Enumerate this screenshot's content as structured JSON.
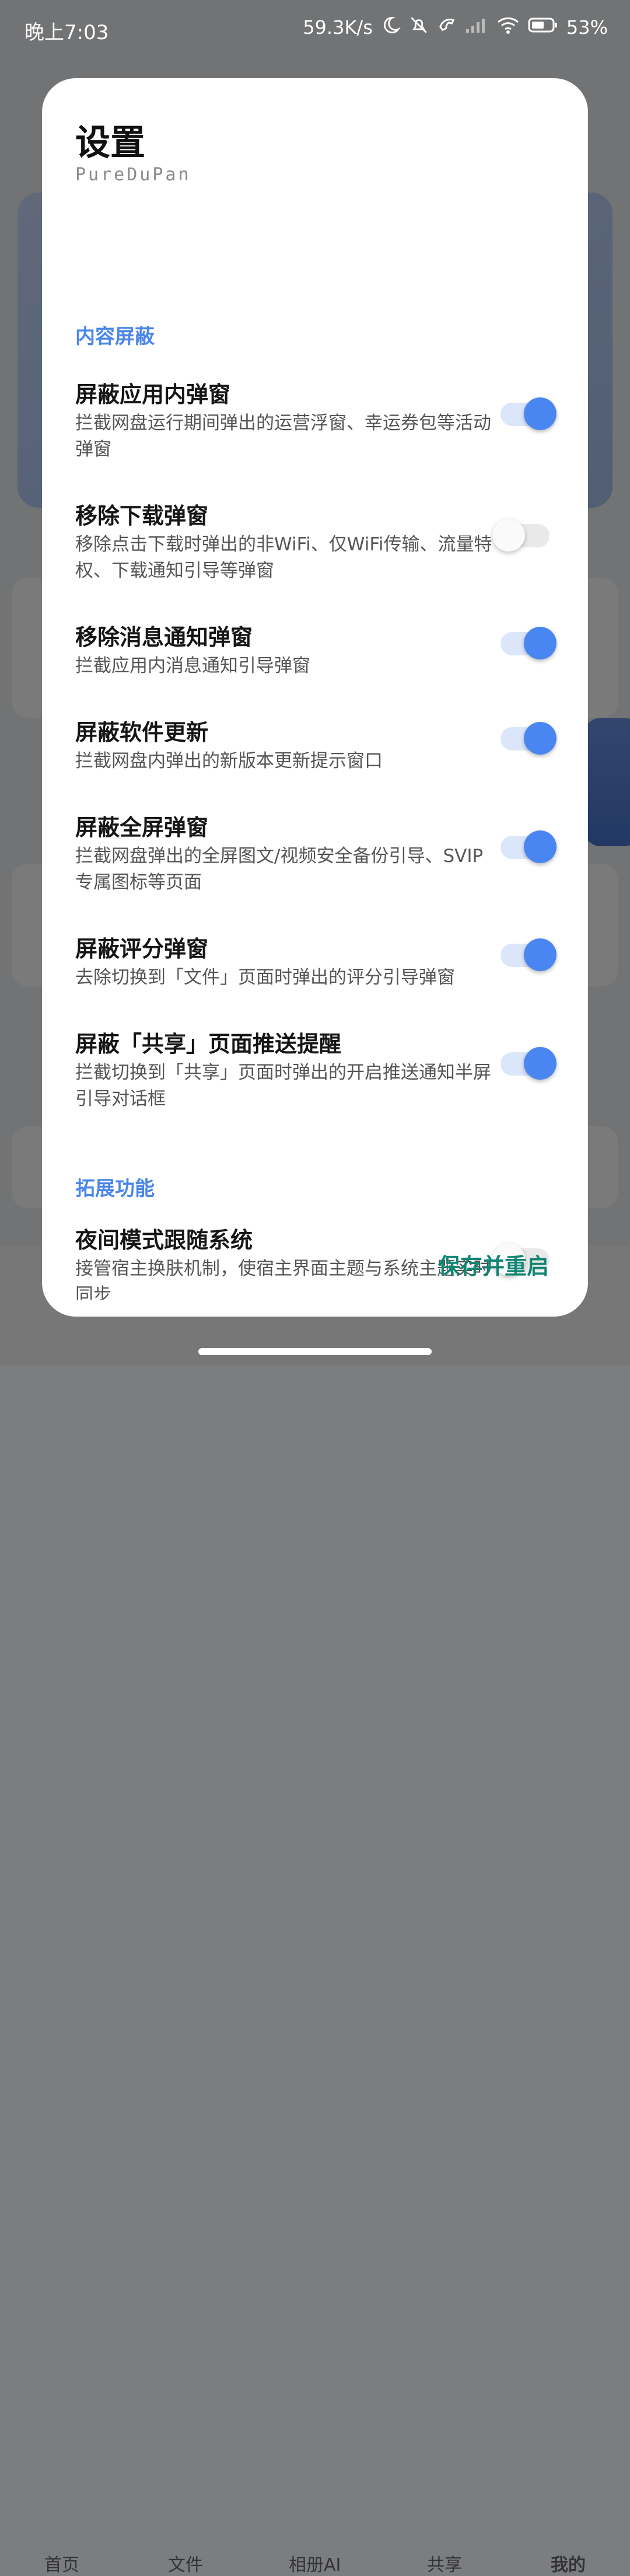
{
  "status_bar": {
    "time": "晚上7:03",
    "speed": "59.3K/s",
    "battery": "53%"
  },
  "background_tabs": [
    "首页",
    "文件",
    "相册AI",
    "共享",
    "我的"
  ],
  "dialog": {
    "title": "设置",
    "subtitle": "PureDuPan",
    "sections": [
      {
        "header": "内容屏蔽",
        "items": [
          {
            "title": "屏蔽应用内弹窗",
            "desc": "拦截网盘运行期间弹出的运营浮窗、幸运券包等活动弹窗",
            "enabled": true
          },
          {
            "title": "移除下载弹窗",
            "desc": "移除点击下载时弹出的非WiFi、仅WiFi传输、流量特权、下载通知引导等弹窗",
            "enabled": false
          },
          {
            "title": "移除消息通知弹窗",
            "desc": "拦截应用内消息通知引导弹窗",
            "enabled": true
          },
          {
            "title": "屏蔽软件更新",
            "desc": "拦截网盘内弹出的新版本更新提示窗口",
            "enabled": true
          },
          {
            "title": "屏蔽全屏弹窗",
            "desc": "拦截网盘弹出的全屏图文/视频安全备份引导、SVIP专属图标等页面",
            "enabled": true
          },
          {
            "title": "屏蔽评分弹窗",
            "desc": "去除切换到「文件」页面时弹出的评分引导弹窗",
            "enabled": true
          },
          {
            "title": "屏蔽「共享」页面推送提醒",
            "desc": "拦截切换到「共享」页面时弹出的开启推送通知半屏引导对话框",
            "enabled": true
          }
        ]
      },
      {
        "header": "拓展功能",
        "items": [
          {
            "title": "夜间模式跟随系统",
            "desc": "接管宿主换肤机制，使宿主界面主题与系统主题实时同步",
            "enabled": false
          }
        ]
      }
    ],
    "action_label": "保存并重启"
  },
  "colors": {
    "accent": "#4a86e8",
    "action": "#108573",
    "toggle_on": "#4a86f2"
  }
}
